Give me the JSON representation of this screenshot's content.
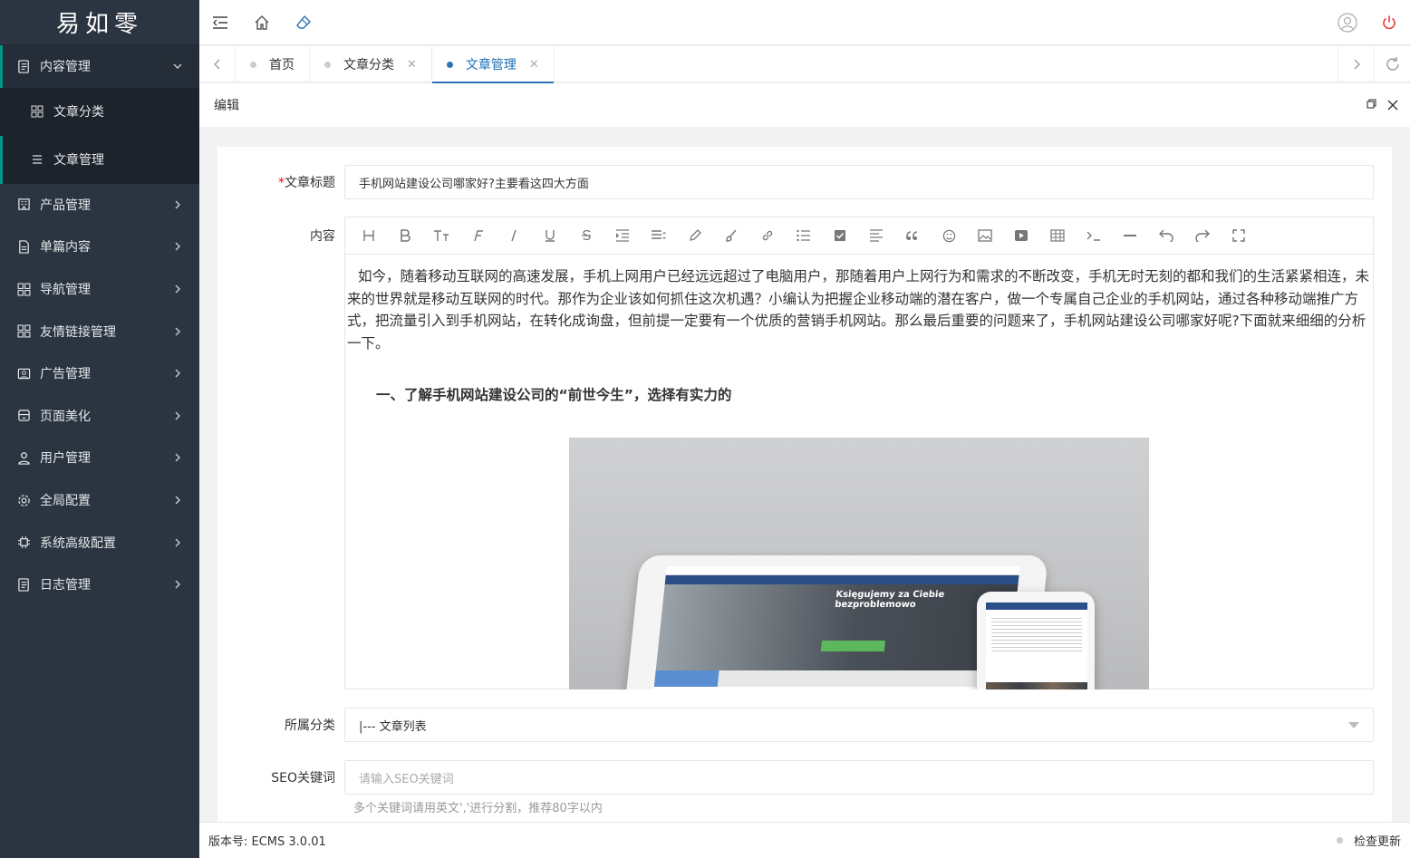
{
  "logo": "易如零",
  "sidebar": {
    "items": [
      {
        "label": "内容管理",
        "icon": "document-icon"
      },
      {
        "label": "产品管理",
        "icon": "building-icon"
      },
      {
        "label": "单篇内容",
        "icon": "page-icon"
      },
      {
        "label": "导航管理",
        "icon": "grid-icon"
      },
      {
        "label": "友情链接管理",
        "icon": "grid-icon"
      },
      {
        "label": "广告管理",
        "icon": "image-icon"
      },
      {
        "label": "页面美化",
        "icon": "brush-icon"
      },
      {
        "label": "用户管理",
        "icon": "user-icon"
      },
      {
        "label": "全局配置",
        "icon": "gear-icon"
      },
      {
        "label": "系统高级配置",
        "icon": "chip-icon"
      },
      {
        "label": "日志管理",
        "icon": "log-icon"
      }
    ],
    "sub": [
      {
        "label": "文章分类"
      },
      {
        "label": "文章管理"
      }
    ]
  },
  "tabs": [
    {
      "label": "首页"
    },
    {
      "label": "文章分类"
    },
    {
      "label": "文章管理"
    }
  ],
  "panel": {
    "title": "编辑"
  },
  "form": {
    "title_label": "文章标题",
    "title_required": "*",
    "title_value": "手机网站建设公司哪家好?主要看这四大方面",
    "content_label": "内容",
    "category_label": "所属分类",
    "category_value": "|--- 文章列表",
    "seo_label": "SEO关键词",
    "seo_placeholder": "请输入SEO关键词",
    "seo_hint": "多个关键词请用英文','进行分割，推荐80字以内"
  },
  "editor": {
    "paragraph": "如今，随着移动互联网的高速发展，手机上网用户已经远远超过了电脑用户，那随着用户上网行为和需求的不断改变，手机无时无刻的都和我们的生活紧紧相连，未来的世界就是移动互联网的时代。那作为企业该如何抓住这次机遇？小编认为把握企业移动端的潜在客户，做一个专属自己企业的手机网站，通过各种移动端推广方式，把流量引入到手机网站，在转化成询盘，但前提一定要有一个优质的营销手机网站。那么最后重要的问题来了，手机网站建设公司哪家好呢?下面就来细细的分析一下。",
    "heading": "一、了解手机网站建设公司的“前世今生”，选择有实力的",
    "image_text_1": "Księgujemy za Ciebie",
    "image_text_2": "bezproblemowo"
  },
  "footer": {
    "version": "版本号: ECMS 3.0.01",
    "update": "检查更新"
  },
  "colors": {
    "sidebar_bg": "#2b3542",
    "accent": "#009688",
    "tab_active": "#2b72b6",
    "logout": "#e53935"
  }
}
